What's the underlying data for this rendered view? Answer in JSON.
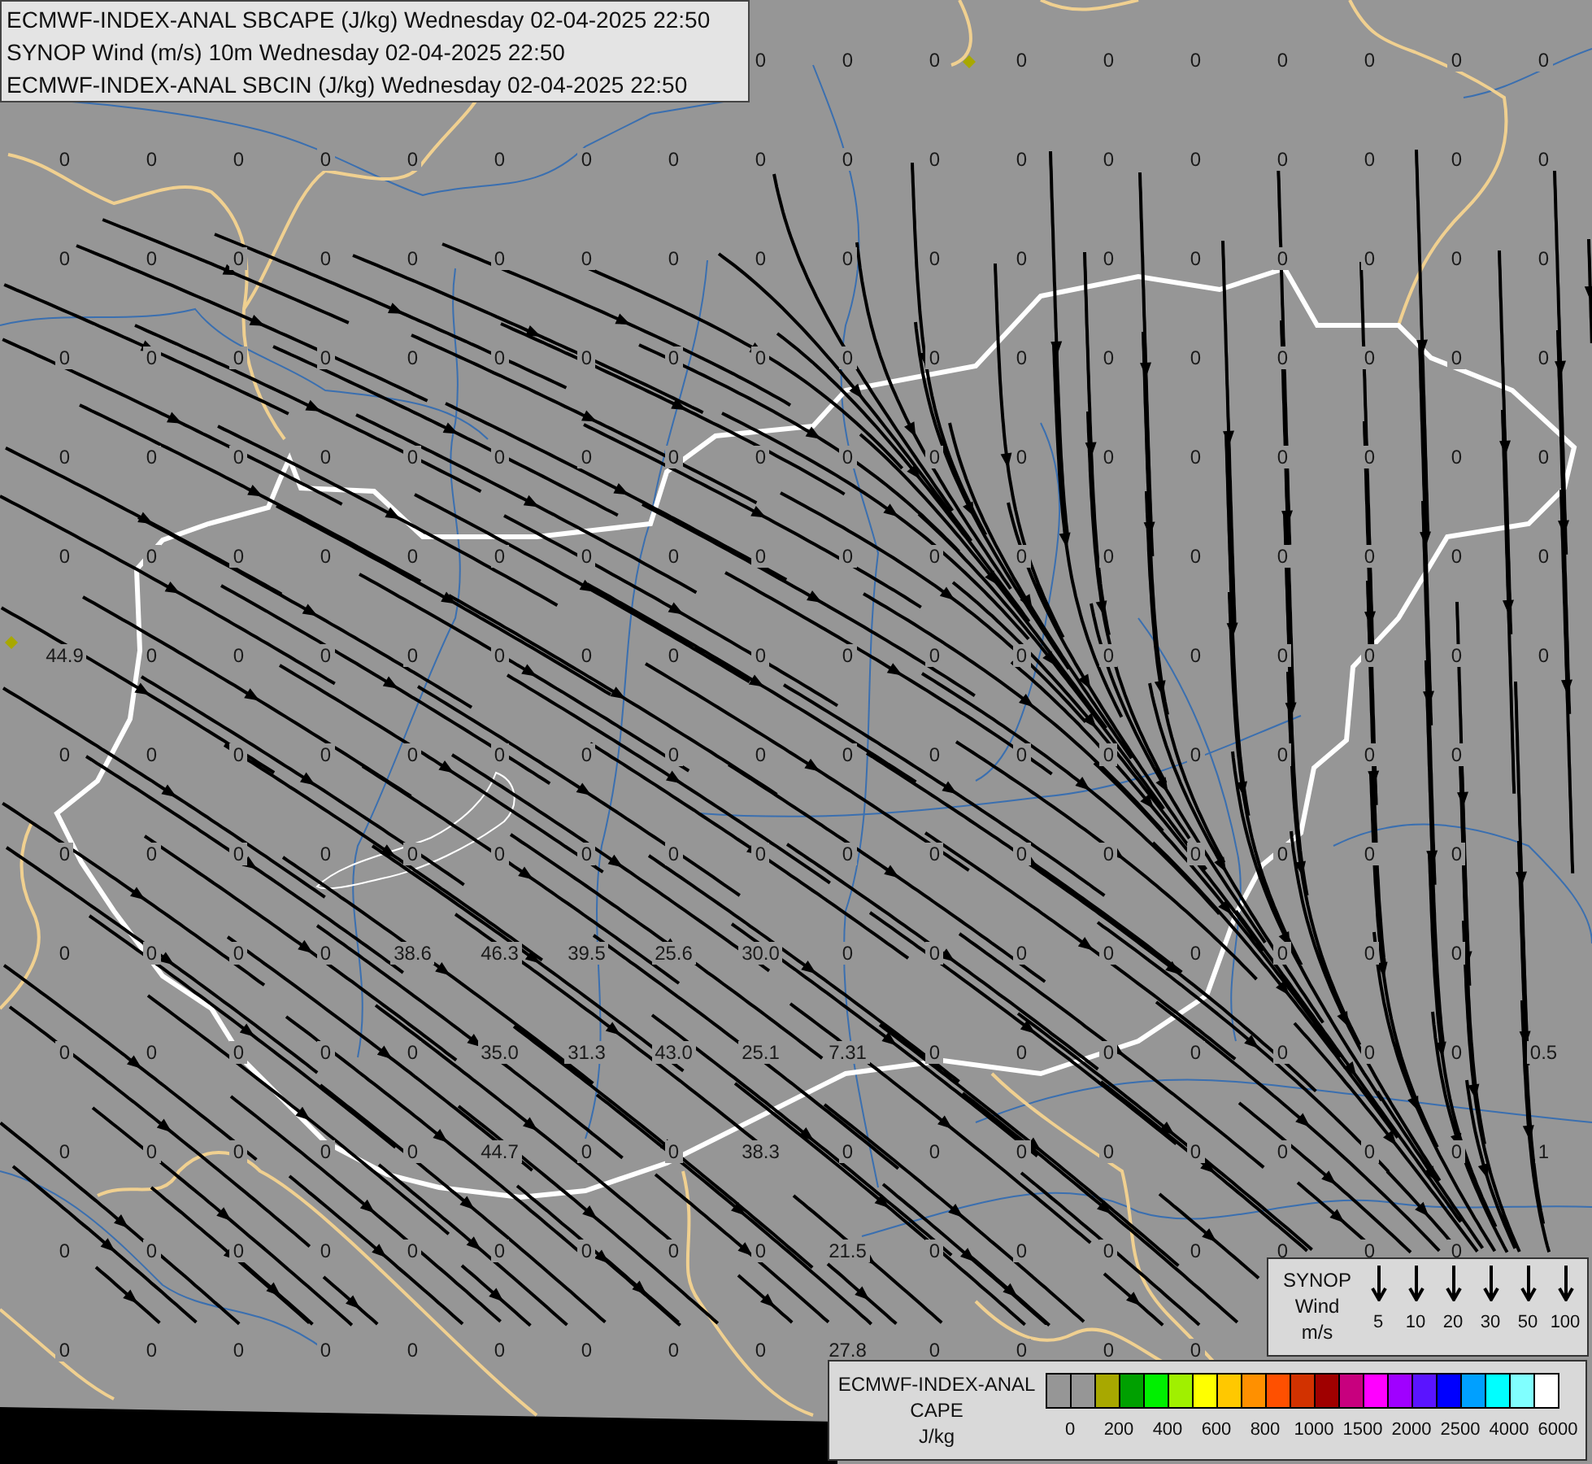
{
  "title_box": {
    "lines": [
      "ECMWF-INDEX-ANAL SBCAPE (J/kg) Wednesday 02-04-2025 22:50",
      "SYNOP Wind (m/s) 10m Wednesday 02-04-2025 22:50",
      "ECMWF-INDEX-ANAL SBCIN (J/kg) Wednesday 02-04-2025 22:50"
    ]
  },
  "map": {
    "value_rows": [
      [
        null,
        null,
        null,
        null,
        null,
        null,
        null,
        null,
        "0",
        "0",
        "0",
        "0",
        "0",
        "0",
        "0",
        "0",
        "0",
        "0"
      ],
      [
        "0",
        "0",
        "0",
        "0",
        "0",
        "0",
        "0",
        "0",
        "0",
        "0",
        "0",
        "0",
        "0",
        "0",
        "0",
        "0",
        "0",
        "0"
      ],
      [
        "0",
        "0",
        "0",
        "0",
        "0",
        "0",
        "0",
        "0",
        "0",
        "0",
        "0",
        "0",
        "0",
        "0",
        "0",
        "0",
        "0",
        "0"
      ],
      [
        "0",
        "0",
        "0",
        "0",
        "0",
        "0",
        "0",
        "0",
        "0",
        "0",
        "0",
        "0",
        "0",
        "0",
        "0",
        "0",
        "0",
        "0"
      ],
      [
        "0",
        "0",
        "0",
        "0",
        "0",
        "0",
        "0",
        "0",
        "0",
        "0",
        "0",
        "0",
        "0",
        "0",
        "0",
        "0",
        "0",
        "0"
      ],
      [
        "0",
        "0",
        "0",
        "0",
        "0",
        "0",
        "0",
        "0",
        "0",
        "0",
        "0",
        "0",
        "0",
        "0",
        "0",
        "0",
        "0",
        "0"
      ],
      [
        "44.9",
        "0",
        "0",
        "0",
        "0",
        "0",
        "0",
        "0",
        "0",
        "0",
        "0",
        "0",
        "0",
        "0",
        "0",
        "0",
        "0",
        "0"
      ],
      [
        "0",
        "0",
        "0",
        "0",
        "0",
        "0",
        "0",
        "0",
        "0",
        "0",
        "0",
        "0",
        "0",
        "0",
        "0",
        "0",
        "0",
        null
      ],
      [
        "0",
        "0",
        "0",
        "0",
        "0",
        "0",
        "0",
        "0",
        "0",
        "0",
        "0",
        "0",
        "0",
        "0",
        "0",
        "0",
        "0",
        null
      ],
      [
        "0",
        "0",
        "0",
        "0",
        "38.6",
        "46.3",
        "39.5",
        "25.6",
        "30.0",
        "0",
        "0",
        "0",
        "0",
        "0",
        "0",
        "0",
        "0",
        null
      ],
      [
        "0",
        "0",
        "0",
        "0",
        "0",
        "35.0",
        "31.3",
        "43.0",
        "25.1",
        "7.31",
        "0",
        "0",
        "0",
        "0",
        "0",
        "0",
        "0",
        "0.5"
      ],
      [
        "0",
        "0",
        "0",
        "0",
        "0",
        "44.7",
        "0",
        "0",
        "38.3",
        "0",
        "0",
        "0",
        "0",
        "0",
        "0",
        "0",
        "0",
        "1"
      ],
      [
        "0",
        "0",
        "0",
        "0",
        "0",
        "0",
        "0",
        "0",
        "0",
        "21.5",
        "0",
        "0",
        "0",
        "0",
        "0",
        "0",
        "0",
        null
      ],
      [
        "0",
        "0",
        "0",
        "0",
        "0",
        "0",
        "0",
        "0",
        "0",
        "27.8",
        "0",
        "0",
        "0",
        "0",
        null,
        null,
        null,
        null
      ]
    ]
  },
  "wind_legend": {
    "title_lines": [
      "SYNOP",
      "Wind",
      "m/s"
    ],
    "speeds": [
      "5",
      "10",
      "20",
      "30",
      "50",
      "100"
    ]
  },
  "cape_legend": {
    "title_lines": [
      "ECMWF-INDEX-ANAL",
      "CAPE",
      "J/kg"
    ],
    "swatches": [
      {
        "color": "#969696"
      },
      {
        "color": "#969696"
      },
      {
        "color": "#a8a800"
      },
      {
        "color": "#00a000"
      },
      {
        "color": "#00f000"
      },
      {
        "color": "#a0f000"
      },
      {
        "color": "#ffff00"
      },
      {
        "color": "#ffc800"
      },
      {
        "color": "#ff9000"
      },
      {
        "color": "#ff5000"
      },
      {
        "color": "#d23200"
      },
      {
        "color": "#a00000"
      },
      {
        "color": "#c8007e"
      },
      {
        "color": "#ff00ff"
      },
      {
        "color": "#a000ff"
      },
      {
        "color": "#5a14ff"
      },
      {
        "color": "#0000ff"
      },
      {
        "color": "#00a0ff"
      },
      {
        "color": "#00ffff"
      },
      {
        "color": "#80ffff"
      },
      {
        "color": "#ffffff"
      }
    ],
    "labels": [
      "0",
      "200",
      "400",
      "600",
      "800",
      "1000",
      "1500",
      "2000",
      "2500",
      "4000",
      "6000"
    ]
  }
}
